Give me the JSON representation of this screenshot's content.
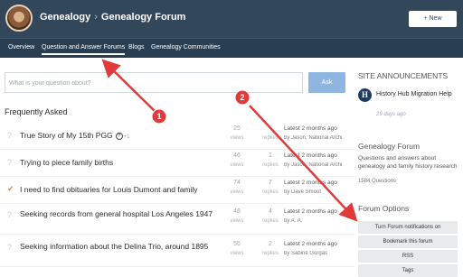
{
  "header": {
    "breadcrumb_root": "Genealogy",
    "breadcrumb_separator": "›",
    "breadcrumb_current": "Genealogy Forum",
    "new_button": "+ New"
  },
  "nav": {
    "items": [
      {
        "label": "Overview"
      },
      {
        "label": "Question and Answer Forums"
      },
      {
        "label": "Blogs"
      },
      {
        "label": "Genealogy Communities"
      }
    ]
  },
  "search": {
    "placeholder": "What is your question about?",
    "value": "",
    "ask_label": "Ask"
  },
  "main": {
    "section_title": "Frequently Asked",
    "views_label": "views",
    "replies_label": "replies",
    "questions": [
      {
        "title": "True Story of My 15th PGG",
        "views": "25",
        "replies": "",
        "latest": "Latest 2 months ago",
        "by": "by Jason, National Archi",
        "answered": false,
        "info": true,
        "plus": "+1"
      },
      {
        "title": "Trying to piece family births",
        "views": "46",
        "replies": "1",
        "latest": "Latest 2 months ago",
        "by": "by Jason, National Archi",
        "answered": false,
        "info": false,
        "plus": ""
      },
      {
        "title": "I need to find obituaries for Louis Dumont and family",
        "views": "74",
        "replies": "7",
        "latest": "Latest 2 months ago",
        "by": "by Dave Smoot",
        "answered": true,
        "info": false,
        "plus": ""
      },
      {
        "title": "Seeking records from general hospital Los Angeles 1947",
        "views": "48",
        "replies": "4",
        "latest": "Latest 2 months ago",
        "by": "by A. A.",
        "answered": false,
        "info": false,
        "plus": ""
      },
      {
        "title": "Seeking information about the Delina Trio, around 1895",
        "views": "55",
        "replies": "2",
        "latest": "Latest 2 months ago",
        "by": "by Sabine Gorgas",
        "answered": false,
        "info": false,
        "plus": ""
      }
    ]
  },
  "sidebar": {
    "announcements_title": "SITE ANNOUNCEMENTS",
    "announcement": {
      "logo_letter": "H",
      "title": "History Hub Migration Help",
      "date": "29 days ago"
    },
    "forum_title": "Genealogy Forum",
    "forum_desc": "Questions and answers about genealogy and family history research",
    "forum_count": "1584 Questions",
    "options_title": "Forum Options",
    "options": [
      {
        "label": "Turn Forum notifications on"
      },
      {
        "label": "Bookmark this forum"
      },
      {
        "label": "RSS"
      },
      {
        "label": "Tags"
      }
    ]
  },
  "annotations": {
    "marker_1": "1",
    "marker_2": "2",
    "arrow_color": "#e03a3a"
  },
  "colors": {
    "header_bg": "#33475b",
    "nav_bg": "#2a3e52",
    "ask_button": "#8fb6e0",
    "answered_check": "#e87e2c"
  }
}
